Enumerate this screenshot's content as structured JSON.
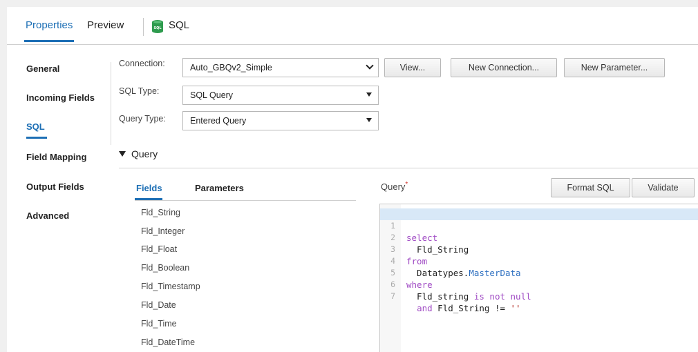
{
  "tabs": {
    "properties": "Properties",
    "preview": "Preview",
    "current_title": "SQL",
    "current_icon": "sql-database-icon",
    "current_icon_text": "SQL"
  },
  "colors": {
    "accent": "#1d6fb5",
    "icon_green": "#2e9b4e",
    "required": "#d0342c"
  },
  "sidenav": {
    "items": [
      {
        "label": "General",
        "active": false
      },
      {
        "label": "Incoming Fields",
        "active": false
      },
      {
        "label": "SQL",
        "active": true
      },
      {
        "label": "Field Mapping",
        "active": false
      },
      {
        "label": "Output Fields",
        "active": false
      },
      {
        "label": "Advanced",
        "active": false
      }
    ]
  },
  "form": {
    "connection": {
      "label": "Connection:",
      "value": "Auto_GBQv2_Simple"
    },
    "sql_type": {
      "label": "SQL Type:",
      "value": "SQL Query"
    },
    "query_type": {
      "label": "Query Type:",
      "value": "Entered Query"
    },
    "buttons": {
      "view": "View...",
      "new_connection": "New Connection...",
      "new_parameter": "New Parameter..."
    }
  },
  "query_section": {
    "title": "Query",
    "tabs": {
      "fields": "Fields",
      "parameters": "Parameters"
    },
    "fields": [
      "Fld_String",
      "Fld_Integer",
      "Fld_Float",
      "Fld_Boolean",
      "Fld_Timestamp",
      "Fld_Date",
      "Fld_Time",
      "Fld_DateTime"
    ],
    "editor_label": "Query",
    "required_mark": "*",
    "format_sql": "Format SQL",
    "validate": "Validate",
    "highlighted_line": 1,
    "lines": [
      {
        "num": "1",
        "text": "select"
      },
      {
        "num": "2",
        "text": "  Fld_String"
      },
      {
        "num": "3",
        "text": "from"
      },
      {
        "num": "4",
        "text": "  Datatypes.MasterData"
      },
      {
        "num": "5",
        "text": "where"
      },
      {
        "num": "6",
        "text": "  Fld_string is not null"
      },
      {
        "num": "7",
        "text": "  and Fld_String != ''"
      }
    ]
  }
}
